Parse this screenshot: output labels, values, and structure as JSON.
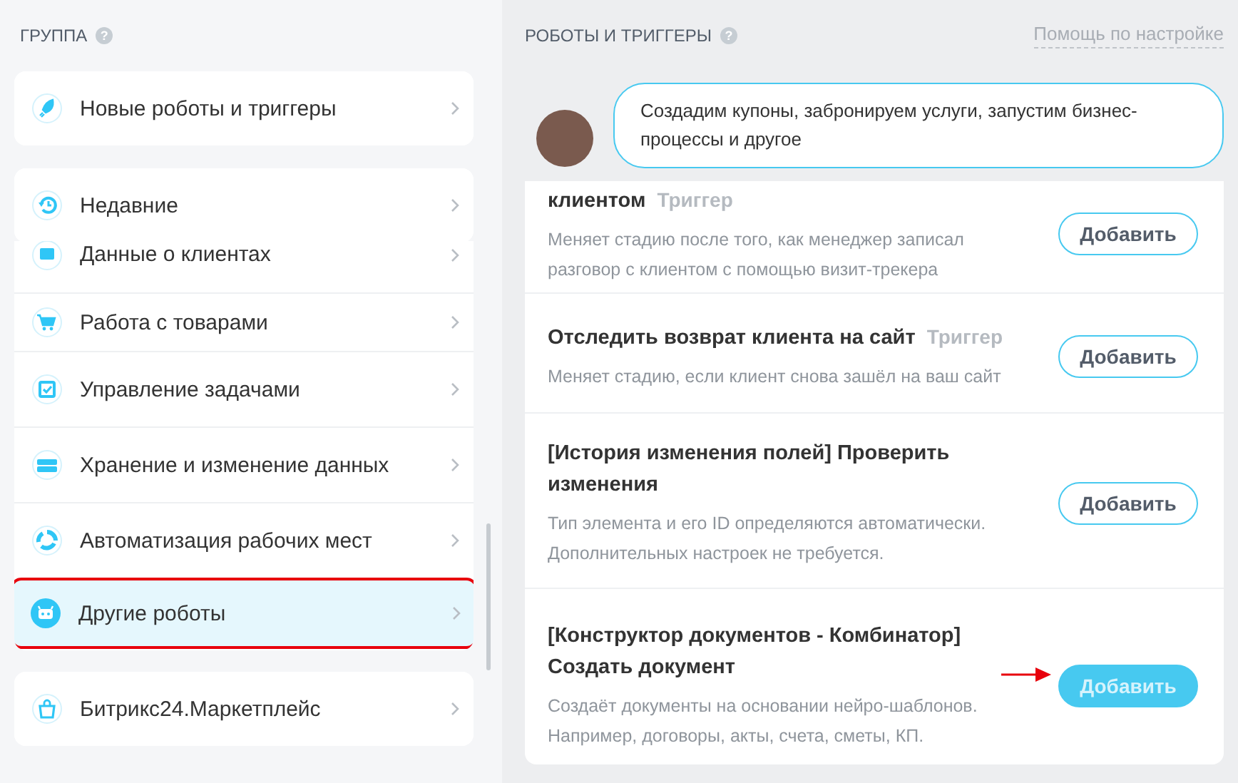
{
  "left_panel": {
    "title": "ГРУППА",
    "help_icon": "?",
    "pinned": [
      {
        "label": "Новые роботы и триггеры"
      },
      {
        "label": "Недавние"
      }
    ],
    "groups": [
      {
        "label": "Данные о клиентах",
        "selected": false
      },
      {
        "label": "Работа с товарами",
        "selected": false
      },
      {
        "label": "Управление задачами",
        "selected": false
      },
      {
        "label": "Хранение и изменение данных",
        "selected": false
      },
      {
        "label": "Автоматизация рабочих мест",
        "selected": false
      },
      {
        "label": "Другие роботы",
        "selected": true
      }
    ],
    "marketplace": {
      "label": "Битрикс24.Маркетплейс"
    }
  },
  "right_panel": {
    "title": "РОБОТЫ И ТРИГГЕРЫ",
    "help_icon": "?",
    "help_link": "Помощь по настройке",
    "tip": "Создадим купоны, забронируем услуги, запустим бизнес-процессы и другое",
    "robots": [
      {
        "title": "клиентом",
        "tag": "Триггер",
        "description": "Меняет стадию после того, как менеджер записал разговор с клиентом с помощью визит-трекера",
        "button": "Добавить",
        "primary": false
      },
      {
        "title": "Отследить возврат клиента на сайт",
        "tag": "Триггер",
        "description": "Меняет стадию, если клиент снова зашёл на ваш сайт",
        "button": "Добавить",
        "primary": false
      },
      {
        "title": "[История изменения полей] Проверить изменения",
        "description": "Тип элемента и его ID определяются автоматически. Дополнительных настроек не требуется.",
        "button": "Добавить",
        "primary": false
      },
      {
        "title": "[Конструктор документов - Комбинатор] Создать документ",
        "description": "Создаёт документы на основании нейро-шаблонов. Например, договоры, акты, счета, сметы, КП.",
        "button": "Добавить",
        "primary": true
      }
    ]
  }
}
